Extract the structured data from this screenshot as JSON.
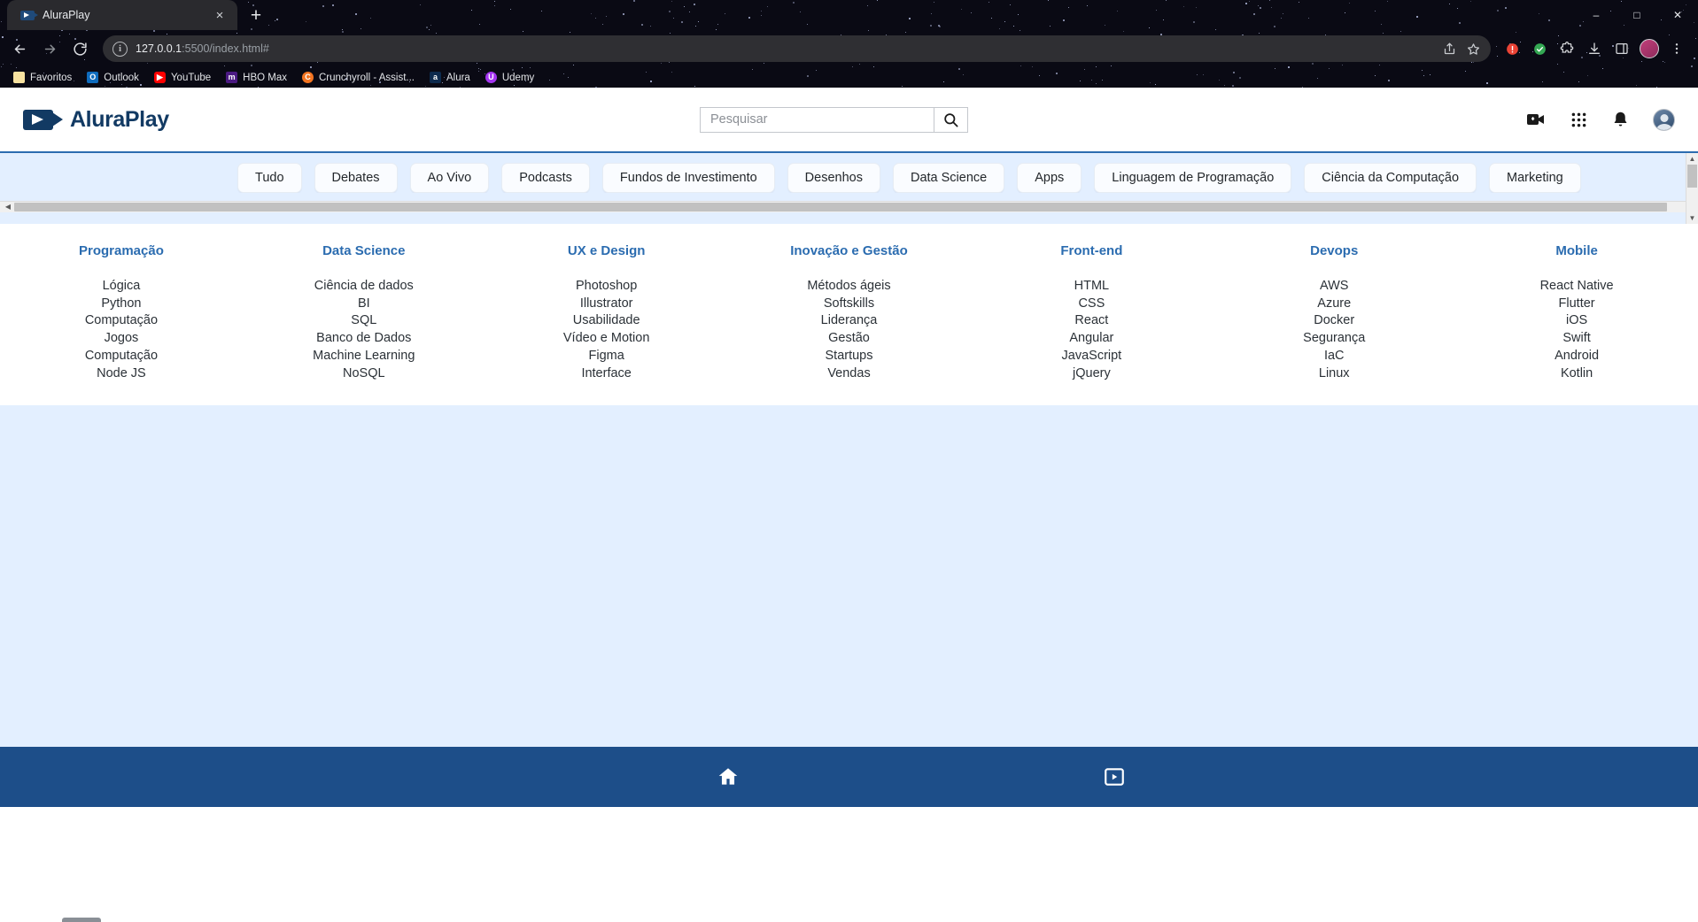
{
  "browser": {
    "tab": {
      "title": "AluraPlay",
      "favicon": "aluraplay-video-icon",
      "close_label": "×"
    },
    "new_tab_label": "+",
    "window_controls": {
      "minimize": "–",
      "maximize": "□",
      "close": "✕"
    },
    "nav": {
      "back": "back-arrow",
      "forward": "forward-arrow",
      "reload": "reload-arrow"
    },
    "omnibox": {
      "info_glyph": "i",
      "url_host": "127.0.0.1",
      "url_path": ":5500/index.html#",
      "share_icon": "share-icon",
      "bookmark_icon": "star-icon"
    },
    "toolbar_icons": [
      {
        "name": "extension-alert-icon",
        "glyph": "●",
        "color": "#ea4335"
      },
      {
        "name": "extension-green-icon",
        "glyph": "●",
        "color": "#34a853"
      },
      {
        "name": "puzzle-extensions-icon",
        "glyph": "❖"
      },
      {
        "name": "downloads-icon",
        "glyph": "⬇"
      },
      {
        "name": "side-panel-icon",
        "glyph": "◨"
      },
      {
        "name": "profile-avatar",
        "glyph": ""
      },
      {
        "name": "chrome-menu-icon",
        "glyph": "⋮"
      }
    ],
    "bookmarks": [
      {
        "label": "Favoritos",
        "icon": "folder-icon",
        "icon_class": "ic-folder",
        "glyph": ""
      },
      {
        "label": "Outlook",
        "icon": "outlook-icon",
        "icon_class": "ic-outlook",
        "glyph": "O"
      },
      {
        "label": "YouTube",
        "icon": "youtube-icon",
        "icon_class": "ic-youtube",
        "glyph": "▶"
      },
      {
        "label": "HBO Max",
        "icon": "hbomax-icon",
        "icon_class": "ic-hbo",
        "glyph": "m"
      },
      {
        "label": "Crunchyroll - Assist...",
        "icon": "crunchyroll-icon",
        "icon_class": "ic-crunchy",
        "glyph": "C"
      },
      {
        "label": "Alura",
        "icon": "alura-icon",
        "icon_class": "ic-alura",
        "glyph": "a"
      },
      {
        "label": "Udemy",
        "icon": "udemy-icon",
        "icon_class": "ic-udemy",
        "glyph": "U"
      }
    ]
  },
  "site": {
    "logo_text": "AluraPlay",
    "logo_icon": "video-camera-play-icon",
    "search": {
      "placeholder": "Pesquisar",
      "value": "",
      "button_icon": "search-icon"
    },
    "header_actions": [
      {
        "name": "create-video-icon",
        "glyph": "video-plus"
      },
      {
        "name": "apps-grid-icon",
        "glyph": "grid"
      },
      {
        "name": "notifications-bell-icon",
        "glyph": "bell"
      },
      {
        "name": "account-avatar",
        "glyph": "avatar"
      }
    ],
    "categories": [
      "Tudo",
      "Debates",
      "Ao Vivo",
      "Podcasts",
      "Fundos de Investimento",
      "Desenhos",
      "Data Science",
      "Apps",
      "Linguagem de Programação",
      "Ciência da Computação",
      "Marketing"
    ],
    "columns": [
      {
        "title": "Programação",
        "links": [
          "Lógica",
          "Python",
          "Computação",
          "Jogos",
          "Computação",
          "Node JS"
        ]
      },
      {
        "title": "Data Science",
        "links": [
          "Ciência de dados",
          "BI",
          "SQL",
          "Banco de Dados",
          "Machine Learning",
          "NoSQL"
        ]
      },
      {
        "title": "UX e Design",
        "links": [
          "Photoshop",
          "Illustrator",
          "Usabilidade",
          "Vídeo e Motion",
          "Figma",
          "Interface"
        ]
      },
      {
        "title": "Inovação e Gestão",
        "links": [
          "Métodos ágeis",
          "Softskills",
          "Liderança",
          "Gestão",
          "Startups",
          "Vendas"
        ]
      },
      {
        "title": "Front-end",
        "links": [
          "HTML",
          "CSS",
          "React",
          "Angular",
          "JavaScript",
          "jQuery"
        ]
      },
      {
        "title": "Devops",
        "links": [
          "AWS",
          "Azure",
          "Docker",
          "Segurança",
          "IaC",
          "Linux"
        ]
      },
      {
        "title": "Mobile",
        "links": [
          "React Native",
          "Flutter",
          "iOS",
          "Swift",
          "Android",
          "Kotlin"
        ]
      }
    ],
    "footer_icons": [
      {
        "name": "home-icon",
        "glyph": "home"
      },
      {
        "name": "video-library-icon",
        "glyph": "video-library"
      }
    ]
  },
  "colors": {
    "accent_blue": "#2b6cb0",
    "footer_blue": "#1d4e89",
    "band_blue": "#e3efff",
    "logo_blue": "#123a63"
  }
}
